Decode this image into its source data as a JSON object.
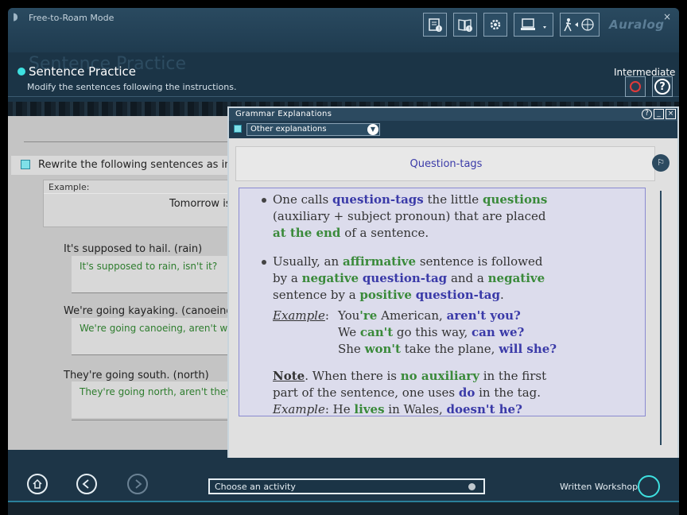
{
  "window": {
    "mode_title": "Free-to-Roam Mode",
    "close_glyph": "×",
    "brand": "Auralog"
  },
  "toolbar": {
    "icons": [
      "notebook-alert-icon",
      "book-alert-icon",
      "gear-icon",
      "computer-dropdown-icon",
      "walker-globe-icon"
    ]
  },
  "header": {
    "ghost_title": "Sentence Practice",
    "title": "Sentence Practice",
    "subtitle": "Modify the sentences following the instructions.",
    "level": "Intermediate",
    "help_glyph": "?"
  },
  "exercise": {
    "instruction": "Rewrite the following sentences as in the",
    "example_label": "Example:",
    "example_text": "Tomorrow is",
    "items": [
      {
        "prompt": "It's supposed to hail. (rain)",
        "answer": "It's supposed to rain, isn't it?"
      },
      {
        "prompt": "We're going kayaking. (canoeing)",
        "answer": "We're going canoeing, aren't we"
      },
      {
        "prompt": "They're going south. (north)",
        "answer": "They're going north, aren't they?"
      }
    ]
  },
  "grammar": {
    "window_title": "Grammar Explanations",
    "ctrl_help": "?",
    "ctrl_min": "_",
    "ctrl_close": "×",
    "dropdown_value": "Other explanations",
    "dropdown_arrow": "▼",
    "heading": "Question-tags",
    "p1": {
      "t1": "One calls ",
      "k1": "question-tags",
      "t2": " the little ",
      "k2": "questions",
      "t3": "(auxiliary + subject pronoun) that are placed",
      "k3": "at the end",
      "t4": " of a sentence."
    },
    "p2": {
      "t1": "Usually, an ",
      "k1": "affirmative",
      "t2": " sentence is followed",
      "t3": "by a ",
      "k2": "negative",
      "k3": "question-tag",
      "t4": " and a ",
      "k4": "negative",
      "t5": "sentence by a ",
      "k5": "positive",
      "k6": "question-tag",
      "t6": "."
    },
    "examples": {
      "label": "Example",
      "colon": ":",
      "e1a": "You",
      "e1b": "'re",
      "e1c": " American, ",
      "e1d": "aren't you?",
      "e2a": "We ",
      "e2b": "can't",
      "e2c": " go this way, ",
      "e2d": "can we?",
      "e3a": "She ",
      "e3b": "won't",
      "e3c": " take the plane, ",
      "e3d": "will she?"
    },
    "note": {
      "label": "Note",
      "t1": ". When there is ",
      "k1": "no auxiliary",
      "t2": " in the first",
      "t3": "part of the sentence, one uses ",
      "k2": "do",
      "t4": " in the tag.",
      "ex_label": "Example",
      "t5": ": He ",
      "k3": "lives",
      "t6": " in Wales, ",
      "k4": "doesn't he?"
    }
  },
  "bottom": {
    "activity_placeholder": "Choose an activity",
    "workshop_label": "Written Workshop"
  }
}
